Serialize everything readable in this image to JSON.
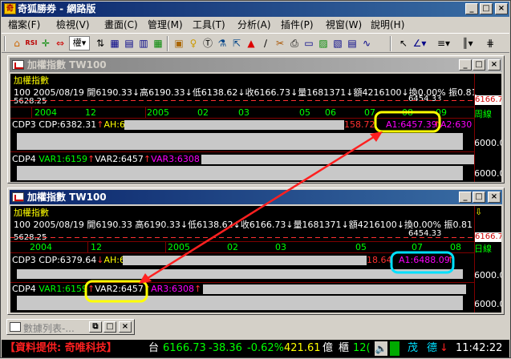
{
  "app": {
    "title": "奇狐勝券 - 網路版",
    "icon_label": "奇",
    "window_buttons": [
      "_",
      "□",
      "×"
    ]
  },
  "menu": [
    "檔案(F)",
    "檢視(V)",
    "畫面(C)",
    "管理(M)",
    "工具(T)",
    "分析(A)",
    "插件(P)",
    "視窗(W)",
    "說明(H)"
  ],
  "toolbar": {
    "icons": [
      "home-icon",
      "rsi-icon",
      "move-icon",
      "double-arrow-icon",
      "index-select",
      "sort-icon",
      "grid-icon",
      "layout-icon",
      "chart-icon",
      "grid2-icon",
      "stock-icon",
      "bulb-icon",
      "lab-icon",
      "alarm-icon",
      "wand-icon",
      "text-icon",
      "export-icon",
      "print-icon",
      "window-icon",
      "photo-icon",
      "compare-icon",
      "pointer-icon",
      "line-icon",
      "multi-line-icon",
      "bar-icon",
      "grid-lines-icon"
    ],
    "index_select_label": "權"
  },
  "panes": [
    {
      "title": "加權指數 TW100",
      "state": "inactive",
      "name_cn": "加權指數",
      "info": {
        "code": "100",
        "date": "2005/08/19",
        "open": "開6190.33",
        "high": "高6190.33",
        "low": "低6138.62",
        "close": "收6166.73",
        "vol": "量1681371",
        "amt": "額4216100",
        "turnover": "換0.00%",
        "amp": "振0.81"
      },
      "price_min_label": "5628.25",
      "price_mid_label": "6454.33",
      "last_price": "6166.7",
      "time_axis": [
        {
          "label": "2004"
        },
        {
          "label": "12"
        },
        {
          "label": "2005"
        },
        {
          "label": "02"
        },
        {
          "label": "03"
        },
        {
          "label": "05"
        },
        {
          "label": "06"
        },
        {
          "label": "07"
        },
        {
          "label": "08"
        },
        {
          "label": "09"
        }
      ],
      "period": "周線",
      "cdp": {
        "label": "CDP3",
        "cdp": "CDP:6382.31",
        "ah": "AH:64",
        "tail": "158.72",
        "a1": "A1:6457.39",
        "a2": "A2:630",
        "scale": "6000.0"
      },
      "cdp4": {
        "label": "CDP4",
        "var1": "VAR1:6159",
        "var2": "VAR2:6457",
        "var3": "VAR3:6308",
        "v": "V",
        "scale": "6000.0"
      }
    },
    {
      "title": "加權指數 TW100",
      "state": "active",
      "name_cn": "加權指數",
      "info": {
        "code": "100",
        "date": "2005/08/19",
        "open": "開6190.33",
        "high": "高6190.33",
        "low": "低6138.62",
        "close": "收6166.73",
        "vol": "量1681371",
        "amt": "額4216100",
        "turnover": "換0.00%",
        "amp": "振0.81"
      },
      "price_min_label": "5628.25",
      "price_mid_label": "6454.33",
      "last_price": "6166.7",
      "time_axis": [
        {
          "label": "2004"
        },
        {
          "label": "12"
        },
        {
          "label": "2005"
        },
        {
          "label": "02"
        },
        {
          "label": "03"
        },
        {
          "label": "05"
        },
        {
          "label": "07"
        },
        {
          "label": "08"
        }
      ],
      "period": "日線",
      "cdp": {
        "label": "CDP3",
        "cdp": "CDP:6379.64",
        "ah": "AH:64",
        "tail": "18.64",
        "a1": "A1:6488.09",
        "scale": "6000.0"
      },
      "cdp4": {
        "label": "CDP4",
        "var1": "VAR1:6159",
        "var2": "VAR2:6457",
        "var3": "AR3:6308",
        "scale": "6000.0"
      }
    }
  ],
  "minimized": {
    "title": "數據列表-..."
  },
  "status": {
    "provider": "【資料提供: 奇唯科技】",
    "market": "台",
    "index": "6166.73",
    "change": "-38.36",
    "pct": "-0.62%",
    "amount": "421.61",
    "unit": "億",
    "board": "櫃",
    "board_val": "12(",
    "flag1": "茂",
    "flag2": "德",
    "time": "11:42:22"
  },
  "colors": {
    "up": "#ff3030",
    "cdp_label": "#ffffff",
    "var1": "#00ff00",
    "var2": "#ffffff",
    "var3": "#ff00ff",
    "a1": "#ff00ff",
    "annotation_arrow": "#ff2020",
    "annotation_yellow": "#ffff00",
    "annotation_cyan": "#00e0ff"
  }
}
